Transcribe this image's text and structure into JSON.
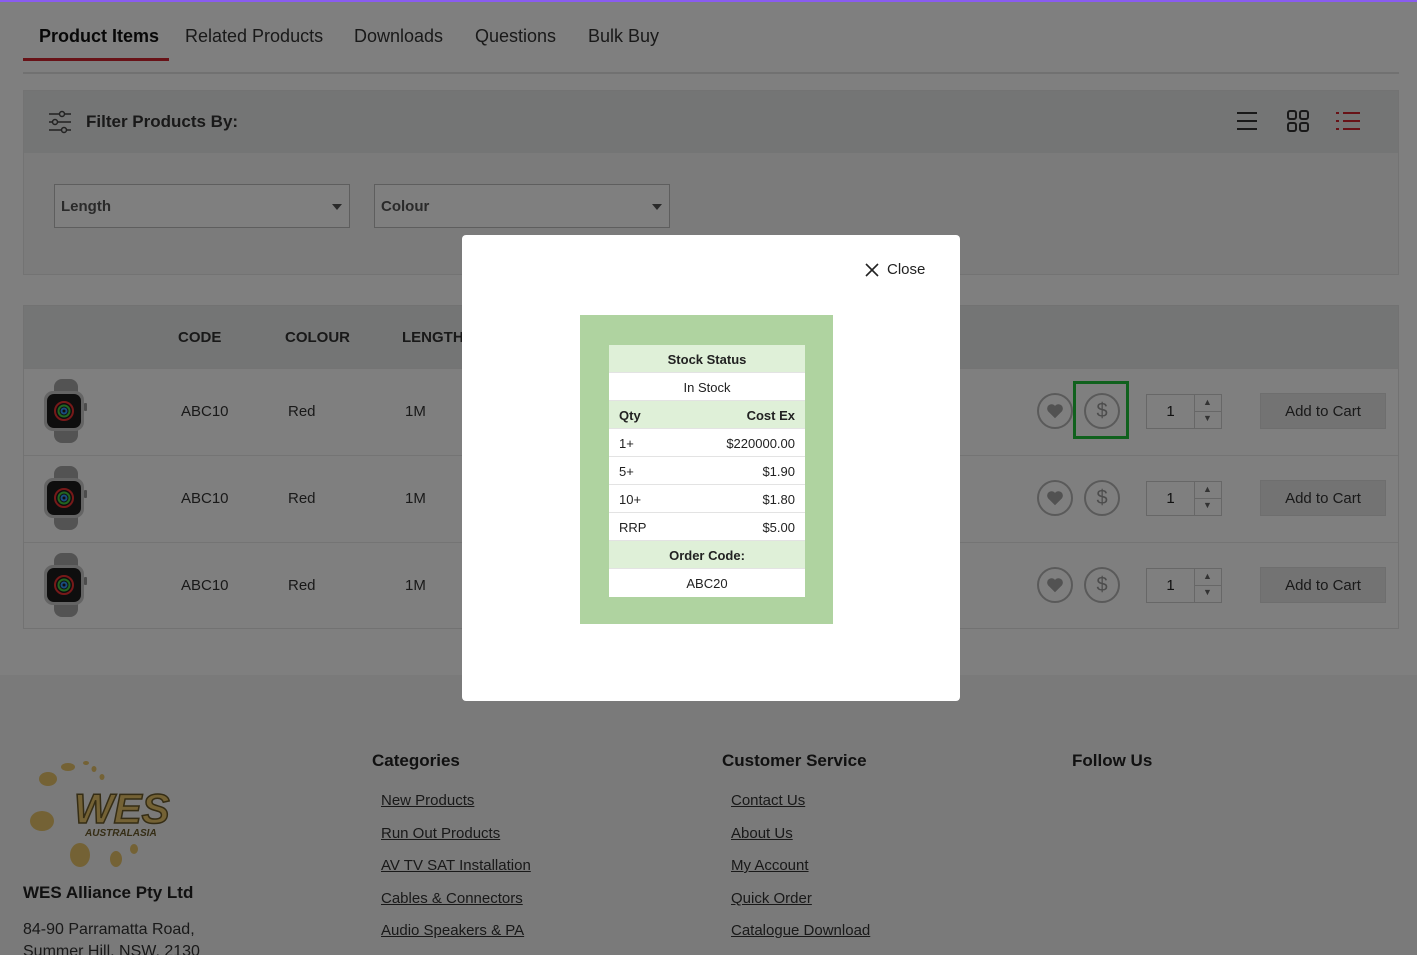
{
  "tabs": {
    "product_items": "Product Items",
    "related_products": "Related Products",
    "downloads": "Downloads",
    "questions": "Questions",
    "bulk_buy": "Bulk Buy"
  },
  "filter": {
    "title": "Filter Products By:",
    "length_select": "Length",
    "colour_select": "Colour",
    "views": [
      "list-view-icon",
      "grid-view-icon",
      "detail-list-view-icon"
    ]
  },
  "table": {
    "headers": {
      "code": "CODE",
      "colour": "COLOUR",
      "length": "LENGTH"
    },
    "rows": [
      {
        "code": "ABC10",
        "colour": "Red",
        "length": "1M",
        "qty": "1",
        "cart": "Add to Cart"
      },
      {
        "code": "ABC10",
        "colour": "Red",
        "length": "1M",
        "qty": "1",
        "cart": "Add to Cart"
      },
      {
        "code": "ABC10",
        "colour": "Red",
        "length": "1M",
        "qty": "1",
        "cart": "Add to Cart"
      }
    ],
    "price_symbol": "$"
  },
  "modal": {
    "close_label": "Close",
    "stock_status_label": "Stock Status",
    "stock_status": "In Stock",
    "qty_header": "Qty",
    "cost_header": "Cost Ex",
    "prices": [
      {
        "qty": "1+",
        "cost": "$220000.00"
      },
      {
        "qty": "5+",
        "cost": "$1.90"
      },
      {
        "qty": "10+",
        "cost": "$1.80"
      },
      {
        "qty": "RRP",
        "cost": "$5.00"
      }
    ],
    "order_code_label": "Order Code:",
    "order_code": "ABC20"
  },
  "footer": {
    "logo_text": "WES",
    "logo_subtext": "AUSTRALASIA",
    "company": "WES Alliance Pty Ltd",
    "address_line1": "84-90 Parramatta Road,",
    "address_line2": "Summer Hill, NSW, 2130",
    "categories_title": "Categories",
    "categories": [
      "New Products",
      "Run Out Products",
      "AV TV SAT Installation",
      "Cables & Connectors",
      "Audio Speakers & PA"
    ],
    "customer_service_title": "Customer Service",
    "customer_service": [
      "Contact Us",
      "About Us",
      "My Account",
      "Quick Order",
      "Catalogue Download"
    ],
    "follow_title": "Follow Us"
  },
  "colors": {
    "accent": "#d1242f",
    "highlight": "#21c33b",
    "stock_bg": "#afd3a0"
  }
}
